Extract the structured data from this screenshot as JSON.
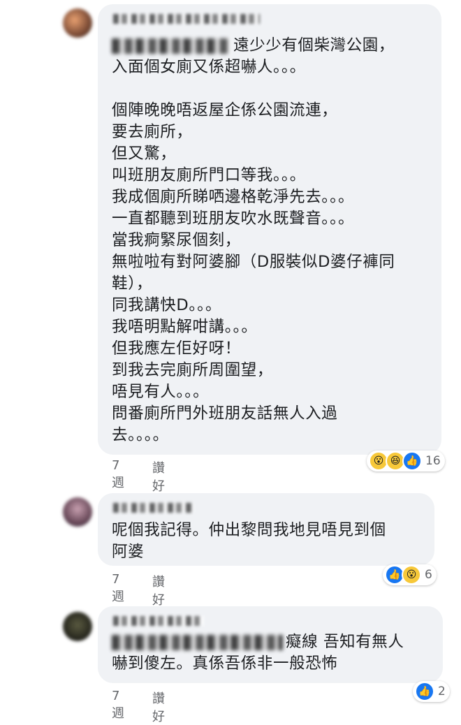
{
  "comments": [
    {
      "prefix_visible": "遠少少有個柴灣公園，",
      "body": "入面個女廁又係超嚇人。。。\n\n個陣晚晚唔返屋企係公園流連，\n要去廁所，\n但又驚，\n叫班朋友廁所門口等我。。。\n我成個廁所睇哂邊格乾淨先去。。。\n一直都聽到班朋友吹水既聲音。。。\n當我痾緊尿個刻，\n無啦啦有對阿婆腳（D服裝似D婆仔褲同\n鞋），\n同我講快D。。。\n我唔明點解咁講。。。\n但我應左佢好呀！\n到我去完廁所周圍望，\n唔見有人。。。\n問番廁所門外班朋友話無人入過\n去。。。。",
      "age": "7週",
      "like_label": "讚好",
      "reactions": [
        "wow-icon",
        "haha-icon",
        "like-icon"
      ],
      "reaction_count": "16"
    },
    {
      "body": "呢個我記得。仲出黎問我地見唔見到個\n阿婆",
      "age": "7週",
      "like_label": "讚好",
      "reactions": [
        "like-icon",
        "wow-icon"
      ],
      "reaction_count": "6"
    },
    {
      "prefix_visible": "癡線 吾知有無人",
      "body": "嚇到傻左。真係吾係非一般恐怖",
      "age": "7週",
      "like_label": "讚好",
      "reactions": [
        "like-icon"
      ],
      "reaction_count": "2"
    }
  ],
  "colors": {
    "bubble": "#f0f2f5",
    "meta": "#65676b",
    "like_blue": "#1877f2",
    "wow_yellow": "#f7c839"
  }
}
